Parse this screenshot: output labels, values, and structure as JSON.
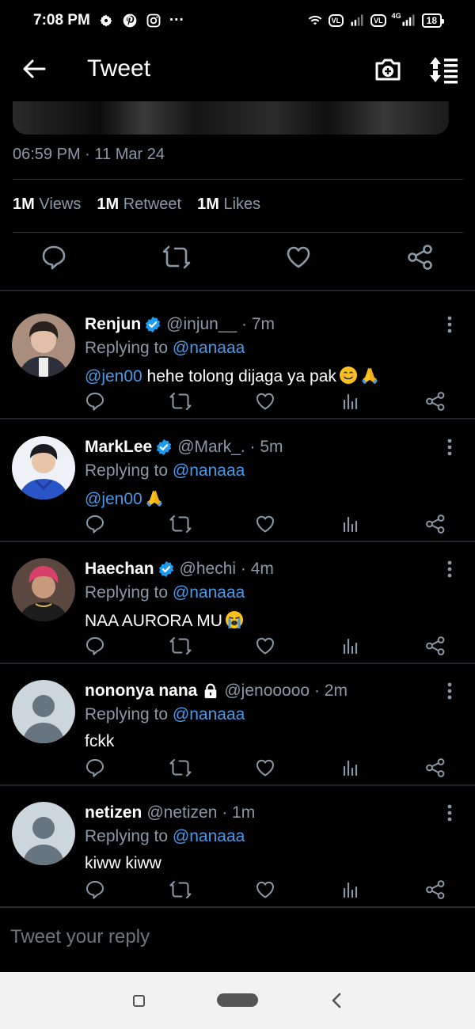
{
  "status_bar": {
    "time": "7:08 PM",
    "ellipsis": "···",
    "network": "4G",
    "vl_label": "VL",
    "battery": "18"
  },
  "top_bar": {
    "title": "Tweet"
  },
  "tweet": {
    "timestamp": "06:59 PM · 11 Mar 24",
    "stats": [
      {
        "count": "1M",
        "label": "Views"
      },
      {
        "count": "1M",
        "label": "Retweet"
      },
      {
        "count": "1M",
        "label": "Likes"
      }
    ]
  },
  "replies": [
    {
      "name": "Renjun",
      "verified": true,
      "handle": "@injun__ · 7m",
      "replying_prefix": "Replying to",
      "replying_to": "@nanaaa",
      "mention": "@jen00",
      "text": " hehe tolong dijaga ya pak",
      "emoji": [
        "smile",
        "pray"
      ],
      "avatar": "photo-renjun"
    },
    {
      "name": "MarkLee",
      "verified": true,
      "handle": "@Mark_. · 5m",
      "replying_prefix": "Replying to",
      "replying_to": "@nanaaa",
      "mention": "@jen00",
      "text": "",
      "emoji": [
        "pray"
      ],
      "avatar": "photo-mark"
    },
    {
      "name": "Haechan",
      "verified": true,
      "handle": "@hechi · 4m",
      "replying_prefix": "Replying to",
      "replying_to": "@nanaaa",
      "mention": "",
      "text": "NAA AURORA MU",
      "emoji": [
        "cry"
      ],
      "avatar": "photo-haechan"
    },
    {
      "name": "nononya nana",
      "verified": false,
      "locked": true,
      "handle": "@jenooooo · 2m",
      "replying_prefix": "Replying to",
      "replying_to": "@nanaaa",
      "mention": "",
      "text": "fckk",
      "emoji": [],
      "avatar": "default"
    },
    {
      "name": "netizen",
      "verified": false,
      "handle": "@netizen · 1m",
      "replying_prefix": "Replying to",
      "replying_to": "@nanaaa",
      "mention": "",
      "text": "kiww kiww",
      "emoji": [],
      "avatar": "default"
    }
  ],
  "compose": {
    "placeholder": "Tweet your reply"
  },
  "colors": {
    "background": "#000000",
    "link": "#4a99e9",
    "secondary_text": "#8b98a5",
    "verified": "#1d9bf0"
  }
}
